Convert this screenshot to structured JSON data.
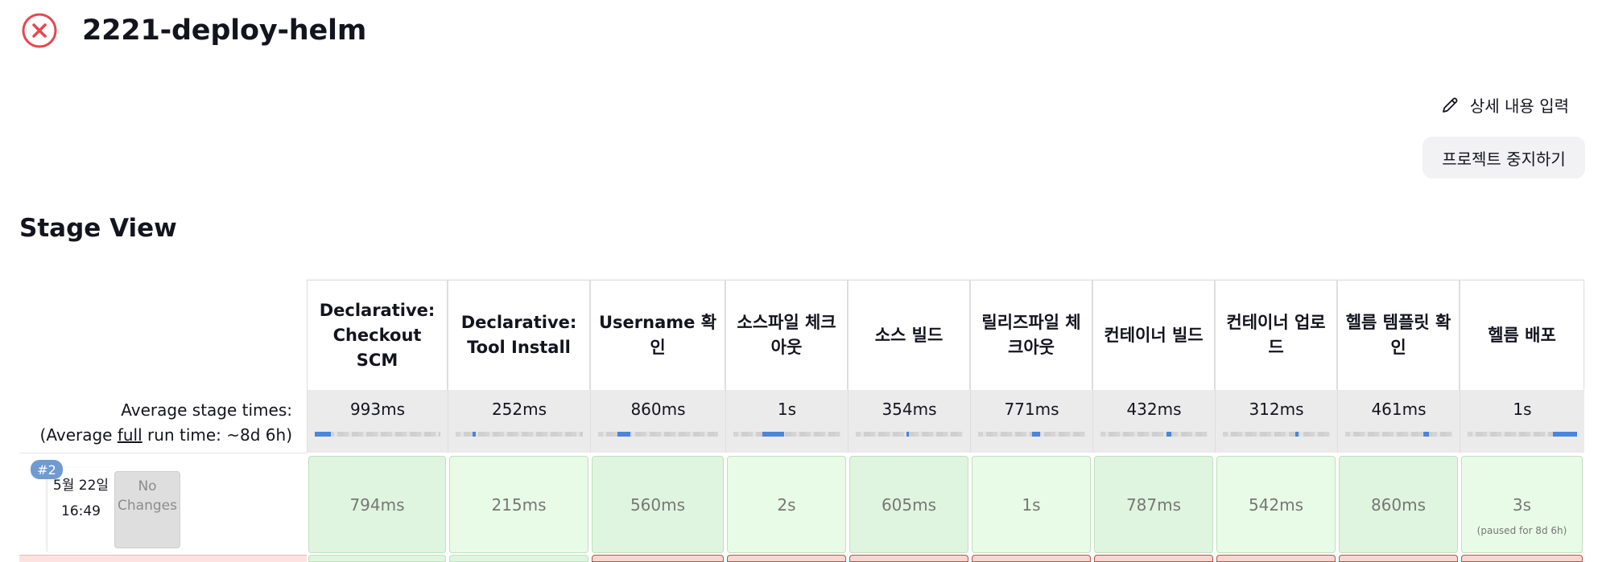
{
  "job": {
    "title": "2221-deploy-helm",
    "status_icon": "failed-x-circle-icon",
    "status_color": "#e5484d"
  },
  "actions": {
    "edit_description": "상세 내용 입력",
    "stop_project": "프로젝트 중지하기"
  },
  "stage_view": {
    "title": "Stage View",
    "average_label": "Average stage times:",
    "full_runtime_prefix": "(Average ",
    "full_runtime_link": "full",
    "full_runtime_suffix": " run time: ~8d 6h)",
    "stages": [
      {
        "name": "Declarative: Checkout SCM",
        "avg": "993ms",
        "bar_fraction": 0.13,
        "bar_start": 0.0
      },
      {
        "name": "Declarative: Tool Install",
        "avg": "252ms",
        "bar_fraction": 0.03,
        "bar_start": 0.13
      },
      {
        "name": "Username 확인",
        "avg": "860ms",
        "bar_fraction": 0.11,
        "bar_start": 0.16
      },
      {
        "name": "소스파일 체크아웃",
        "avg": "1s",
        "bar_fraction": 0.2,
        "bar_start": 0.27
      },
      {
        "name": "소스 빌드",
        "avg": "354ms",
        "bar_fraction": 0.03,
        "bar_start": 0.47
      },
      {
        "name": "릴리즈파일 체크아웃",
        "avg": "771ms",
        "bar_fraction": 0.08,
        "bar_start": 0.5
      },
      {
        "name": "컨테이너 빌드",
        "avg": "432ms",
        "bar_fraction": 0.04,
        "bar_start": 0.62
      },
      {
        "name": "컨테이너 업로드",
        "avg": "312ms",
        "bar_fraction": 0.03,
        "bar_start": 0.68
      },
      {
        "name": "헬름 템플릿 확인",
        "avg": "461ms",
        "bar_fraction": 0.05,
        "bar_start": 0.73
      },
      {
        "name": "헬름 배포",
        "avg": "1s",
        "bar_fraction": 0.22,
        "bar_start": 0.78
      }
    ],
    "builds": [
      {
        "number": "#2",
        "date": "5월 22일",
        "time": "16:49",
        "changes": "No Changes",
        "results": [
          "794ms",
          "215ms",
          "560ms",
          "2s",
          "605ms",
          "1s",
          "787ms",
          "542ms",
          "860ms",
          "3s"
        ],
        "last_note": "(paused for 8d 6h)",
        "result_color": "#dff5df"
      }
    ],
    "failed_color": "#f9d6d6"
  }
}
